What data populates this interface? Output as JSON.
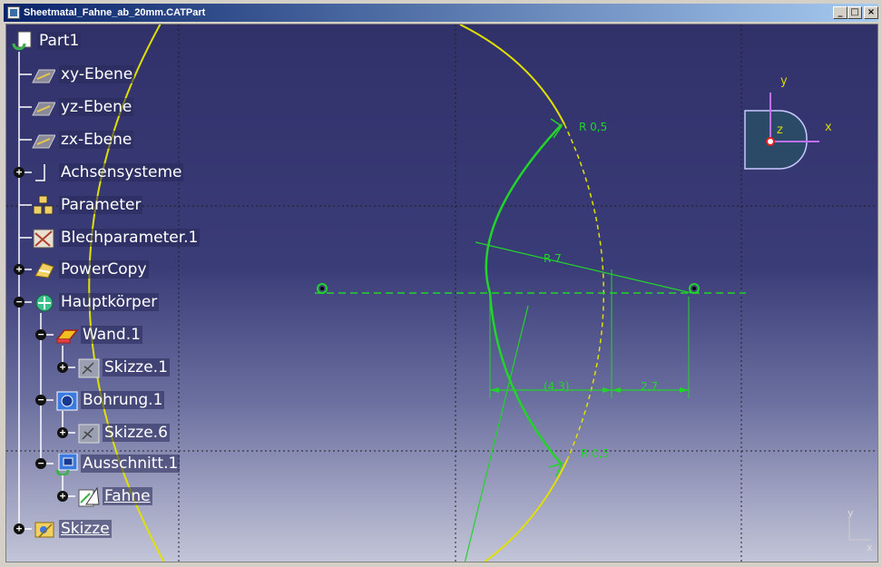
{
  "window": {
    "title": "Sheetmatal_Fahne_ab_20mm.CATPart",
    "controls": {
      "minimize": "_",
      "maximize": "□",
      "close": "×"
    }
  },
  "tree": {
    "root": {
      "label": "Part1",
      "icon": "part-icon"
    },
    "items": [
      {
        "label": "xy-Ebene",
        "icon": "plane-icon",
        "expander": ""
      },
      {
        "label": "yz-Ebene",
        "icon": "plane-icon",
        "expander": ""
      },
      {
        "label": "zx-Ebene",
        "icon": "plane-icon",
        "expander": ""
      },
      {
        "label": "Achsensysteme",
        "icon": "axis-system-icon",
        "expander": "+"
      },
      {
        "label": "Parameter",
        "icon": "parameter-icon",
        "expander": ""
      },
      {
        "label": "Blechparameter.1",
        "icon": "sheetmetal-parameter-icon",
        "expander": ""
      },
      {
        "label": "PowerCopy",
        "icon": "powercopy-icon",
        "expander": "+"
      },
      {
        "label": "Hauptkörper",
        "icon": "body-icon",
        "expander": "−"
      },
      {
        "label": "Wand.1",
        "icon": "wall-icon",
        "expander": "−"
      },
      {
        "label": "Skizze.1",
        "icon": "sketch-icon",
        "expander": "+"
      },
      {
        "label": "Bohrung.1",
        "icon": "hole-icon",
        "expander": "−"
      },
      {
        "label": "Skizze.6",
        "icon": "sketch-icon",
        "expander": "+"
      },
      {
        "label": "Ausschnitt.1",
        "icon": "cutout-icon",
        "expander": "−"
      },
      {
        "label": "Fahne",
        "icon": "flange-icon",
        "expander": "+"
      },
      {
        "label": "Skizze",
        "icon": "sketch-folder-icon",
        "expander": "+"
      }
    ]
  },
  "sketch": {
    "dimensions": {
      "r_top": "R 0,5",
      "r_big": "R 7",
      "d_left": "(4,3)",
      "d_right": "2,7",
      "r_bottom": "R 0,5"
    }
  },
  "compass": {
    "x": "x",
    "y": "y",
    "z": "z"
  },
  "axis_triad": {
    "y": "y",
    "x": "x"
  },
  "colors": {
    "sketch": "#22d42a",
    "construction": "#d8d800",
    "background_top": "#31316a"
  }
}
